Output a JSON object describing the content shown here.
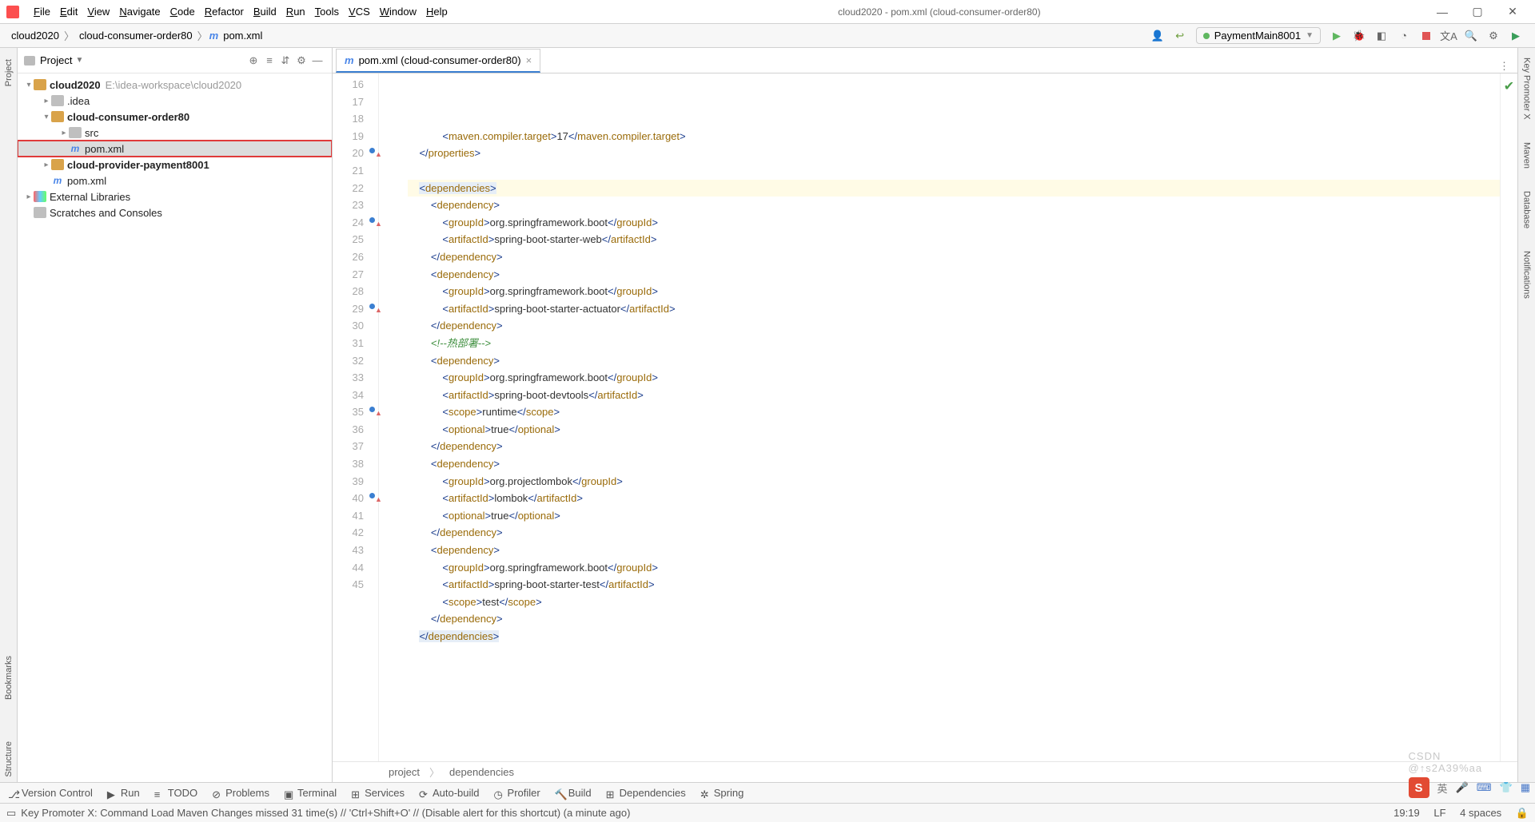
{
  "window": {
    "title": "cloud2020 - pom.xml (cloud-consumer-order80)"
  },
  "menu": [
    "File",
    "Edit",
    "View",
    "Navigate",
    "Code",
    "Refactor",
    "Build",
    "Run",
    "Tools",
    "VCS",
    "Window",
    "Help"
  ],
  "breadcrumbs": {
    "a": "cloud2020",
    "b": "cloud-consumer-order80",
    "c": "pom.xml"
  },
  "runConfig": {
    "name": "PaymentMain8001"
  },
  "projectPane": {
    "title": "Project",
    "root": {
      "name": "cloud2020",
      "path": "E:\\idea-workspace\\cloud2020"
    },
    "nodes": [
      {
        "name": ".idea"
      },
      {
        "name": "cloud-consumer-order80"
      },
      {
        "name": "src"
      },
      {
        "name": "pom.xml"
      },
      {
        "name": "cloud-provider-payment8001"
      },
      {
        "name": "pom.xml"
      },
      {
        "name": "External Libraries"
      },
      {
        "name": "Scratches and Consoles"
      }
    ]
  },
  "editorTab": {
    "label": "pom.xml (cloud-consumer-order80)"
  },
  "gutterStart": 16,
  "code": [
    {
      "n": 16,
      "indent": 3,
      "parts": [
        [
          "tag",
          "<"
        ],
        [
          "tagk",
          "maven.compiler.target"
        ],
        [
          "tag",
          ">"
        ],
        [
          "txt",
          "17"
        ],
        [
          "tag",
          "</"
        ],
        [
          "tagk",
          "maven.compiler.target"
        ],
        [
          "tag",
          ">"
        ]
      ]
    },
    {
      "n": 17,
      "indent": 1,
      "parts": [
        [
          "tag",
          "</"
        ],
        [
          "tagk",
          "properties"
        ],
        [
          "tag",
          ">"
        ]
      ]
    },
    {
      "n": 18,
      "indent": 0,
      "parts": []
    },
    {
      "n": 19,
      "indent": 1,
      "hl": "caret",
      "parts": [
        [
          "tag",
          "<"
        ],
        [
          "tagk",
          "dependencies"
        ],
        [
          "tag",
          ">"
        ]
      ]
    },
    {
      "n": 20,
      "indent": 2,
      "mark": "up",
      "parts": [
        [
          "tag",
          "<"
        ],
        [
          "tagk",
          "dependency"
        ],
        [
          "tag",
          ">"
        ]
      ]
    },
    {
      "n": 21,
      "indent": 3,
      "parts": [
        [
          "tag",
          "<"
        ],
        [
          "tagk",
          "groupId"
        ],
        [
          "tag",
          ">"
        ],
        [
          "txt",
          "org.springframework.boot"
        ],
        [
          "tag",
          "</"
        ],
        [
          "tagk",
          "groupId"
        ],
        [
          "tag",
          ">"
        ]
      ]
    },
    {
      "n": 22,
      "indent": 3,
      "parts": [
        [
          "tag",
          "<"
        ],
        [
          "tagk",
          "artifactId"
        ],
        [
          "tag",
          ">"
        ],
        [
          "txt",
          "spring-boot-starter-web"
        ],
        [
          "tag",
          "</"
        ],
        [
          "tagk",
          "artifactId"
        ],
        [
          "tag",
          ">"
        ]
      ]
    },
    {
      "n": 23,
      "indent": 2,
      "parts": [
        [
          "tag",
          "</"
        ],
        [
          "tagk",
          "dependency"
        ],
        [
          "tag",
          ">"
        ]
      ]
    },
    {
      "n": 24,
      "indent": 2,
      "mark": "up",
      "parts": [
        [
          "tag",
          "<"
        ],
        [
          "tagk",
          "dependency"
        ],
        [
          "tag",
          ">"
        ]
      ]
    },
    {
      "n": 25,
      "indent": 3,
      "parts": [
        [
          "tag",
          "<"
        ],
        [
          "tagk",
          "groupId"
        ],
        [
          "tag",
          ">"
        ],
        [
          "txt",
          "org.springframework.boot"
        ],
        [
          "tag",
          "</"
        ],
        [
          "tagk",
          "groupId"
        ],
        [
          "tag",
          ">"
        ]
      ]
    },
    {
      "n": 26,
      "indent": 3,
      "parts": [
        [
          "tag",
          "<"
        ],
        [
          "tagk",
          "artifactId"
        ],
        [
          "tag",
          ">"
        ],
        [
          "txt",
          "spring-boot-starter-actuator"
        ],
        [
          "tag",
          "</"
        ],
        [
          "tagk",
          "artifactId"
        ],
        [
          "tag",
          ">"
        ]
      ]
    },
    {
      "n": 27,
      "indent": 2,
      "parts": [
        [
          "tag",
          "</"
        ],
        [
          "tagk",
          "dependency"
        ],
        [
          "tag",
          ">"
        ]
      ]
    },
    {
      "n": 28,
      "indent": 2,
      "parts": [
        [
          "cmt",
          "<!--热部署-->"
        ]
      ]
    },
    {
      "n": 29,
      "indent": 2,
      "mark": "up",
      "parts": [
        [
          "tag",
          "<"
        ],
        [
          "tagk",
          "dependency"
        ],
        [
          "tag",
          ">"
        ]
      ]
    },
    {
      "n": 30,
      "indent": 3,
      "parts": [
        [
          "tag",
          "<"
        ],
        [
          "tagk",
          "groupId"
        ],
        [
          "tag",
          ">"
        ],
        [
          "txt",
          "org.springframework.boot"
        ],
        [
          "tag",
          "</"
        ],
        [
          "tagk",
          "groupId"
        ],
        [
          "tag",
          ">"
        ]
      ]
    },
    {
      "n": 31,
      "indent": 3,
      "parts": [
        [
          "tag",
          "<"
        ],
        [
          "tagk",
          "artifactId"
        ],
        [
          "tag",
          ">"
        ],
        [
          "txt",
          "spring-boot-devtools"
        ],
        [
          "tag",
          "</"
        ],
        [
          "tagk",
          "artifactId"
        ],
        [
          "tag",
          ">"
        ]
      ]
    },
    {
      "n": 32,
      "indent": 3,
      "parts": [
        [
          "tag",
          "<"
        ],
        [
          "tagk",
          "scope"
        ],
        [
          "tag",
          ">"
        ],
        [
          "txt",
          "runtime"
        ],
        [
          "tag",
          "</"
        ],
        [
          "tagk",
          "scope"
        ],
        [
          "tag",
          ">"
        ]
      ]
    },
    {
      "n": 33,
      "indent": 3,
      "parts": [
        [
          "tag",
          "<"
        ],
        [
          "tagk",
          "optional"
        ],
        [
          "tag",
          ">"
        ],
        [
          "txt",
          "true"
        ],
        [
          "tag",
          "</"
        ],
        [
          "tagk",
          "optional"
        ],
        [
          "tag",
          ">"
        ]
      ]
    },
    {
      "n": 34,
      "indent": 2,
      "parts": [
        [
          "tag",
          "</"
        ],
        [
          "tagk",
          "dependency"
        ],
        [
          "tag",
          ">"
        ]
      ]
    },
    {
      "n": 35,
      "indent": 2,
      "mark": "up",
      "parts": [
        [
          "tag",
          "<"
        ],
        [
          "tagk",
          "dependency"
        ],
        [
          "tag",
          ">"
        ]
      ]
    },
    {
      "n": 36,
      "indent": 3,
      "parts": [
        [
          "tag",
          "<"
        ],
        [
          "tagk",
          "groupId"
        ],
        [
          "tag",
          ">"
        ],
        [
          "txt",
          "org.projectlombok"
        ],
        [
          "tag",
          "</"
        ],
        [
          "tagk",
          "groupId"
        ],
        [
          "tag",
          ">"
        ]
      ]
    },
    {
      "n": 37,
      "indent": 3,
      "parts": [
        [
          "tag",
          "<"
        ],
        [
          "tagk",
          "artifactId"
        ],
        [
          "tag",
          ">"
        ],
        [
          "txt",
          "lombok"
        ],
        [
          "tag",
          "</"
        ],
        [
          "tagk",
          "artifactId"
        ],
        [
          "tag",
          ">"
        ]
      ]
    },
    {
      "n": 38,
      "indent": 3,
      "parts": [
        [
          "tag",
          "<"
        ],
        [
          "tagk",
          "optional"
        ],
        [
          "tag",
          ">"
        ],
        [
          "txt",
          "true"
        ],
        [
          "tag",
          "</"
        ],
        [
          "tagk",
          "optional"
        ],
        [
          "tag",
          ">"
        ]
      ]
    },
    {
      "n": 39,
      "indent": 2,
      "parts": [
        [
          "tag",
          "</"
        ],
        [
          "tagk",
          "dependency"
        ],
        [
          "tag",
          ">"
        ]
      ]
    },
    {
      "n": 40,
      "indent": 2,
      "mark": "up",
      "parts": [
        [
          "tag",
          "<"
        ],
        [
          "tagk",
          "dependency"
        ],
        [
          "tag",
          ">"
        ]
      ]
    },
    {
      "n": 41,
      "indent": 3,
      "parts": [
        [
          "tag",
          "<"
        ],
        [
          "tagk",
          "groupId"
        ],
        [
          "tag",
          ">"
        ],
        [
          "txt",
          "org.springframework.boot"
        ],
        [
          "tag",
          "</"
        ],
        [
          "tagk",
          "groupId"
        ],
        [
          "tag",
          ">"
        ]
      ]
    },
    {
      "n": 42,
      "indent": 3,
      "parts": [
        [
          "tag",
          "<"
        ],
        [
          "tagk",
          "artifactId"
        ],
        [
          "tag",
          ">"
        ],
        [
          "txt",
          "spring-boot-starter-test"
        ],
        [
          "tag",
          "</"
        ],
        [
          "tagk",
          "artifactId"
        ],
        [
          "tag",
          ">"
        ]
      ]
    },
    {
      "n": 43,
      "indent": 3,
      "parts": [
        [
          "tag",
          "<"
        ],
        [
          "tagk",
          "scope"
        ],
        [
          "tag",
          ">"
        ],
        [
          "txt",
          "test"
        ],
        [
          "tag",
          "</"
        ],
        [
          "tagk",
          "scope"
        ],
        [
          "tag",
          ">"
        ]
      ]
    },
    {
      "n": 44,
      "indent": 2,
      "parts": [
        [
          "tag",
          "</"
        ],
        [
          "tagk",
          "dependency"
        ],
        [
          "tag",
          ">"
        ]
      ]
    },
    {
      "n": 45,
      "indent": 1,
      "hl": "sel",
      "parts": [
        [
          "tag",
          "</"
        ],
        [
          "tagk",
          "dependencies"
        ],
        [
          "tag",
          ">"
        ]
      ]
    }
  ],
  "editorCrumbs": {
    "a": "project",
    "b": "dependencies"
  },
  "bottomTools": [
    "Version Control",
    "Run",
    "TODO",
    "Problems",
    "Terminal",
    "Services",
    "Auto-build",
    "Profiler",
    "Build",
    "Dependencies",
    "Spring"
  ],
  "leftTabs": [
    "Project",
    "Bookmarks",
    "Structure"
  ],
  "rightTabs": [
    "Key Promoter X",
    "Maven",
    "Database",
    "Notifications"
  ],
  "status": {
    "msg": "Key Promoter X: Command Load Maven Changes missed 31 time(s) // 'Ctrl+Shift+O' // (Disable alert for this shortcut) (a minute ago)",
    "pos": "19:19",
    "enc": "LF",
    "indent": "4 spaces"
  },
  "ime": "英",
  "watermark": "CSDN @↑s2A39%aa"
}
